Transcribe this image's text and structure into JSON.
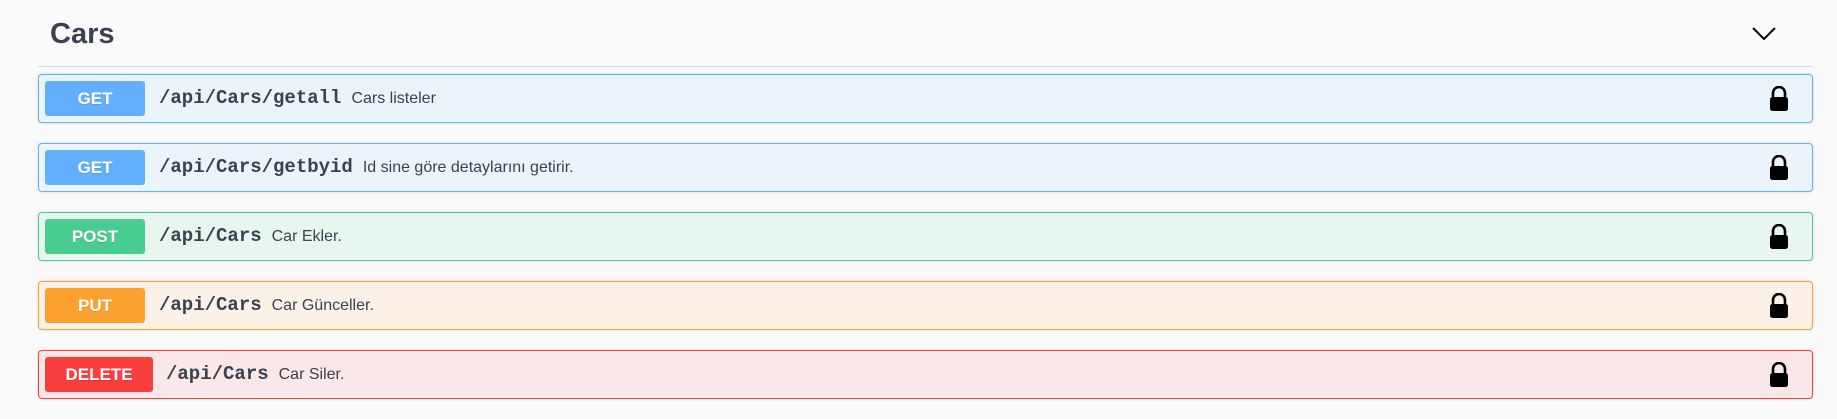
{
  "section": {
    "title": "Cars",
    "expanded_icon": "chevron-down-icon"
  },
  "operations": [
    {
      "method": "GET",
      "path": "/api/Cars/getall",
      "summary": "Cars listeler",
      "lock_icon": "lock-icon"
    },
    {
      "method": "GET",
      "path": "/api/Cars/getbyid",
      "summary": "Id sine göre detaylarını getirir.",
      "lock_icon": "lock-icon"
    },
    {
      "method": "POST",
      "path": "/api/Cars",
      "summary": "Car Ekler.",
      "lock_icon": "lock-icon"
    },
    {
      "method": "PUT",
      "path": "/api/Cars",
      "summary": "Car Günceller.",
      "lock_icon": "lock-icon"
    },
    {
      "method": "DELETE",
      "path": "/api/Cars",
      "summary": "Car Siler.",
      "lock_icon": "lock-icon"
    }
  ],
  "colors": {
    "get": "#61affe",
    "post": "#49cc90",
    "put": "#fca130",
    "delete": "#f93e3e",
    "text": "#3b4151"
  }
}
